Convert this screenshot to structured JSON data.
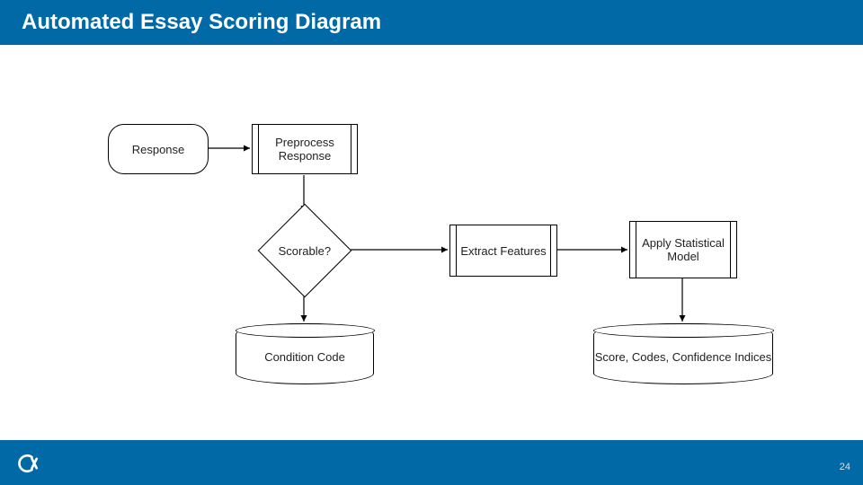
{
  "header": {
    "title": "Automated Essay Scoring Diagram"
  },
  "nodes": {
    "response": "Response",
    "preprocess": "Preprocess Response",
    "scorable": "Scorable?",
    "condition": "Condition Code",
    "extract": "Extract Features",
    "apply": "Apply Statistical Model",
    "output": "Score, Codes, Confidence Indices"
  },
  "edges": [
    {
      "from": "response",
      "to": "preprocess"
    },
    {
      "from": "preprocess",
      "to": "scorable"
    },
    {
      "from": "scorable",
      "to": "extract"
    },
    {
      "from": "scorable",
      "to": "condition"
    },
    {
      "from": "extract",
      "to": "apply"
    },
    {
      "from": "apply",
      "to": "output"
    }
  ],
  "page_number": "24",
  "colors": {
    "brand": "#0069a6"
  }
}
